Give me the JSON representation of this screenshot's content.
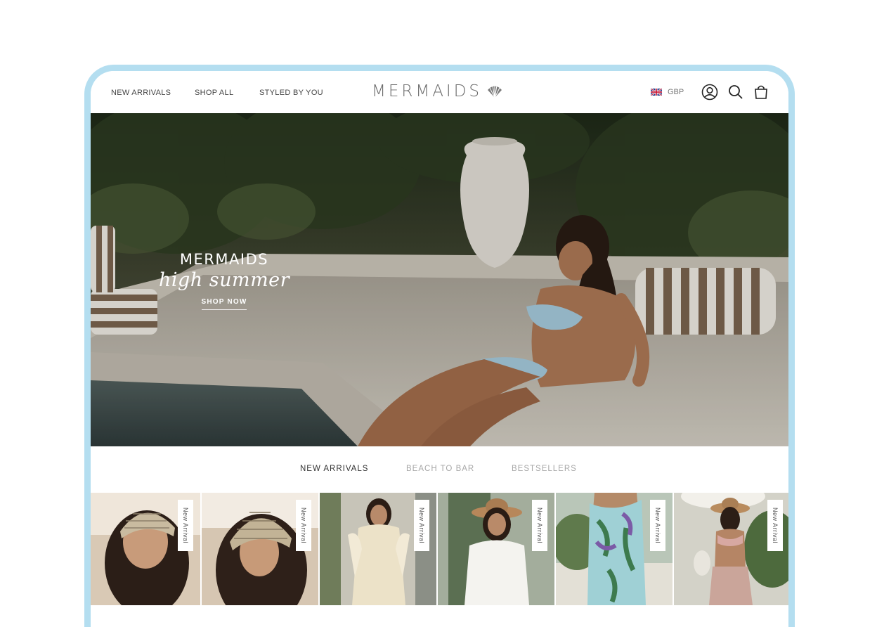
{
  "header": {
    "nav": [
      "NEW ARRIVALS",
      "SHOP ALL",
      "STYLED BY YOU"
    ],
    "logo_text": "MERMAIDS",
    "currency": "GBP",
    "icons": [
      "account-icon",
      "search-icon",
      "bag-icon"
    ]
  },
  "hero": {
    "brand": "MERMAIDS",
    "tagline": "high summer",
    "cta": "SHOP NOW"
  },
  "tabs": {
    "items": [
      "NEW ARRIVALS",
      "BEACH TO BAR",
      "BESTSELLERS"
    ],
    "active": "NEW ARRIVALS"
  },
  "products": {
    "badge": "New Arrival"
  },
  "colors": {
    "frame": "#b4def0",
    "text": "#444444",
    "inactive_tab": "#a8a8a8"
  }
}
